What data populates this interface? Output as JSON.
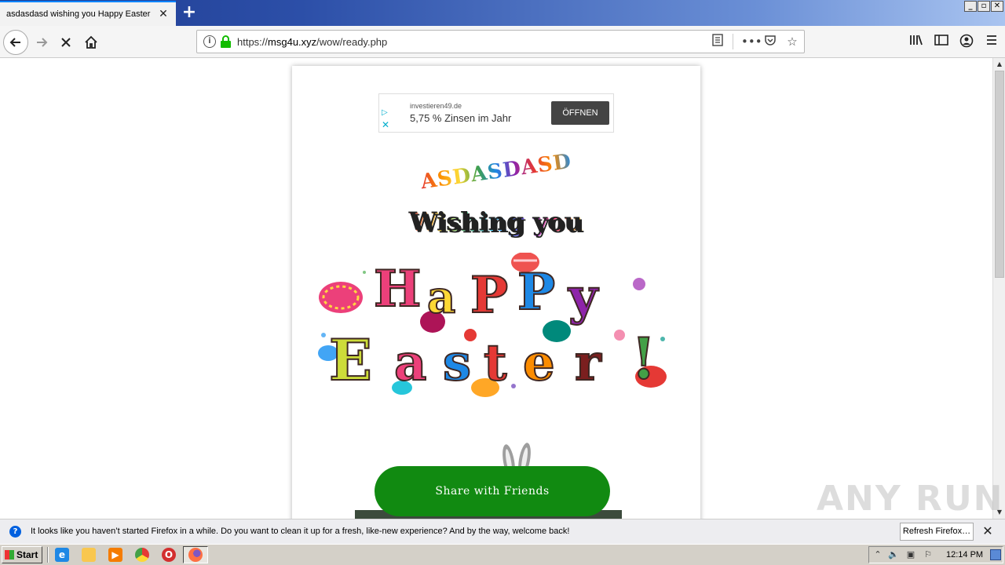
{
  "browser": {
    "tab_title": "asdasdasd wishing you Happy Easter",
    "tab_close": "✕",
    "new_tab": "+",
    "window_controls": [
      "_",
      "▫",
      "✕"
    ],
    "url_scheme": "https://",
    "url_host": "msg4u.xyz",
    "url_path": "/wow/ready.php"
  },
  "page": {
    "ad": {
      "domain": "investieren49.de",
      "headline": "5,75 % Zinsen im Jahr",
      "button": "ÖFFNEN"
    },
    "name_text": "ASDASDASD",
    "wish_text": "Wishing you",
    "greeting_line1": "Happy",
    "greeting_line2": "Easter!",
    "share_button": "Share with Friends",
    "watermark": "ANY RUN"
  },
  "notification": {
    "message": "It looks like you haven’t started Firefox in a while. Do you want to clean it up for a fresh, like-new experience? And by the way, welcome back!",
    "button": "Refresh Firefox…"
  },
  "taskbar": {
    "start_label": "Start",
    "clock": "12:14 PM"
  },
  "colors": {
    "share_green": "#118a11",
    "tab_accent": "#0a84ff",
    "lock_green": "#12bc00"
  }
}
